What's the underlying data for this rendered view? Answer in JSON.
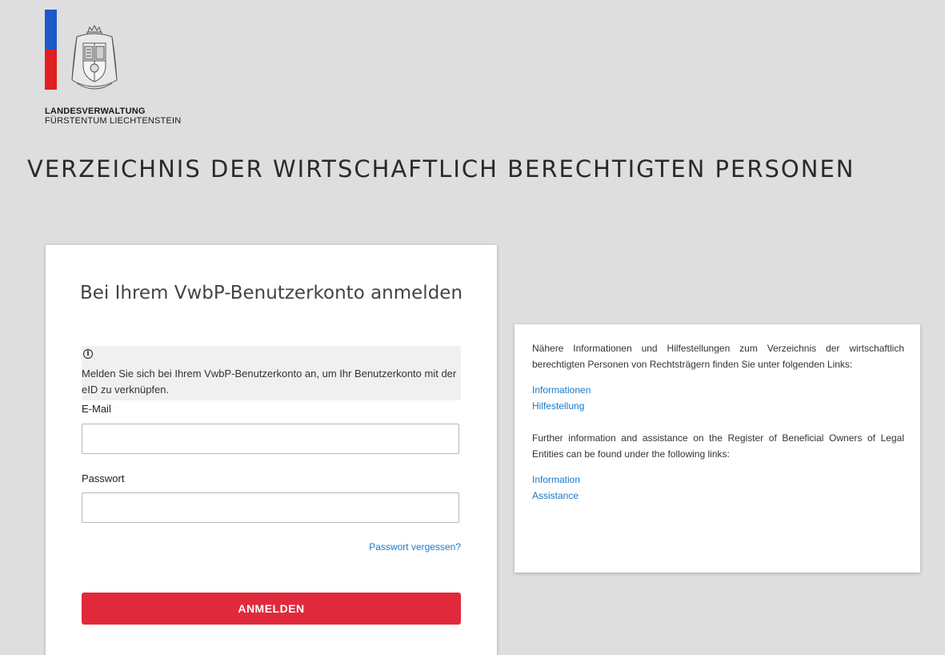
{
  "header": {
    "org_line1": "LANDESVERWALTUNG",
    "org_line2": "FÜRSTENTUM LIECHTENSTEIN",
    "page_title": "VERZEICHNIS DER WIRTSCHAFTLICH BERECHTIGTEN PERSONEN",
    "flag_colors": [
      "#1e58c8",
      "#e02020"
    ]
  },
  "login": {
    "title": "Bei Ihrem VwbP-Benutzerkonto anmelden",
    "info_icon": "info-circle-icon",
    "info_text": "Melden Sie sich bei Ihrem VwbP-Benutzerkonto an, um Ihr Benutzerkonto mit der eID zu verknüpfen.",
    "email_label": "E-Mail",
    "email_value": "",
    "password_label": "Passwort",
    "password_value": "",
    "forgot_link": "Passwort vergessen?",
    "submit_label": "ANMELDEN",
    "submit_color": "#e02a3c"
  },
  "info_panel": {
    "de_text": "Nähere Informationen und Hilfestellungen zum Verzeichnis der wirtschaftlich berechtigten Personen von Rechtsträgern finden Sie unter folgenden Links:",
    "de_links": [
      "Informationen",
      "Hilfestellung"
    ],
    "en_text": "Further information and assistance on the Register of Beneficial Owners of Legal Entities can be found under the following links:",
    "en_links": [
      "Information",
      "Assistance"
    ],
    "link_color": "#1a7ac8"
  }
}
